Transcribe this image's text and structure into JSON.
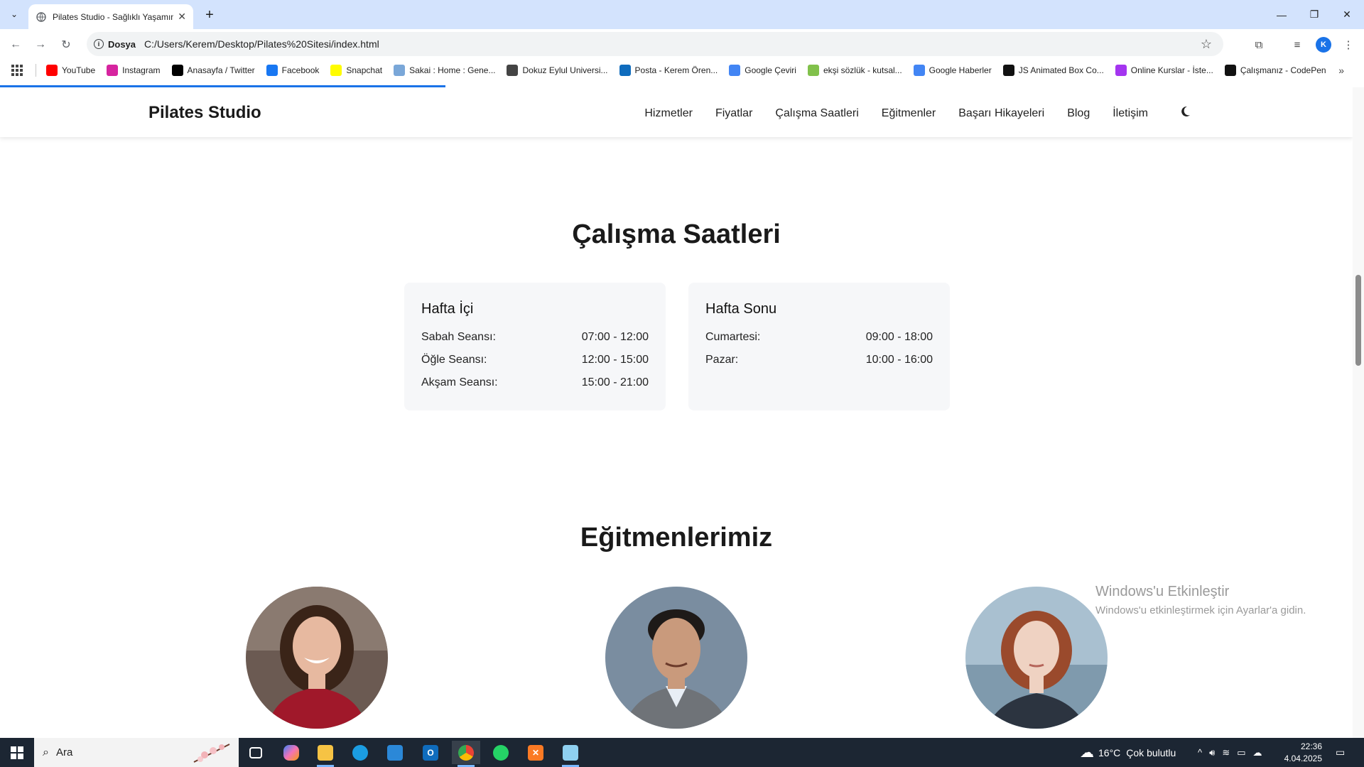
{
  "browser": {
    "tab_title": "Pilates Studio - Sağlıklı Yaşamın",
    "new_tab": "+",
    "security_label": "Dosya",
    "url": "C:/Users/Kerem/Desktop/Pilates%20Sitesi/index.html",
    "profile_initial": "K",
    "bookmarks": [
      {
        "label": "YouTube",
        "icon": "youtube-icon",
        "color": "#ff0000"
      },
      {
        "label": "Instagram",
        "icon": "instagram-icon",
        "color": "#d6249f"
      },
      {
        "label": "Anasayfa / Twitter",
        "icon": "x-icon",
        "color": "#000000"
      },
      {
        "label": "Facebook",
        "icon": "facebook-icon",
        "color": "#1877f2"
      },
      {
        "label": "Snapchat",
        "icon": "snapchat-icon",
        "color": "#fffc00"
      },
      {
        "label": "Sakai : Home : Gene...",
        "icon": "sakai-icon",
        "color": "#7aa7d8"
      },
      {
        "label": "Dokuz Eylul Universi...",
        "icon": "globe-icon",
        "color": "#444444"
      },
      {
        "label": "Posta - Kerem Ören...",
        "icon": "outlook-icon",
        "color": "#0f6cbd"
      },
      {
        "label": "Google Çeviri",
        "icon": "translate-icon",
        "color": "#4285f4"
      },
      {
        "label": "ekşi sözlük - kutsal...",
        "icon": "eksi-icon",
        "color": "#81c14b"
      },
      {
        "label": "Google Haberler",
        "icon": "news-icon",
        "color": "#4285f4"
      },
      {
        "label": "JS Animated Box Co...",
        "icon": "codepen-icon",
        "color": "#111111"
      },
      {
        "label": "Online Kurslar - İste...",
        "icon": "udemy-icon",
        "color": "#a435f0"
      },
      {
        "label": "Çalışmanız - CodePen",
        "icon": "codepen-icon",
        "color": "#111111"
      }
    ]
  },
  "site": {
    "brand": "Pilates Studio",
    "nav": [
      "Hizmetler",
      "Fiyatlar",
      "Çalışma Saatleri",
      "Eğitmenler",
      "Başarı Hikayeleri",
      "Blog",
      "İletişim"
    ],
    "hours_title": "Çalışma Saatleri",
    "weekday": {
      "title": "Hafta İçi",
      "rows": [
        {
          "label": "Sabah Seansı:",
          "time": "07:00 - 12:00"
        },
        {
          "label": "Öğle Seansı:",
          "time": "12:00 - 15:00"
        },
        {
          "label": "Akşam Seansı:",
          "time": "15:00 - 21:00"
        }
      ]
    },
    "weekend": {
      "title": "Hafta Sonu",
      "rows": [
        {
          "label": "Cumartesi:",
          "time": "09:00 - 18:00"
        },
        {
          "label": "Pazar:",
          "time": "10:00 - 16:00"
        }
      ]
    },
    "trainers_title": "Eğitmenlerimiz"
  },
  "watermark": {
    "line1": "Windows'u Etkinleştir",
    "line2": "Windows'u etkinleştirmek için Ayarlar'a gidin."
  },
  "taskbar": {
    "search_placeholder": "Ara",
    "weather_temp": "16°C",
    "weather_text": "Çok bulutlu",
    "time": "22:36",
    "date": "4.04.2025"
  }
}
